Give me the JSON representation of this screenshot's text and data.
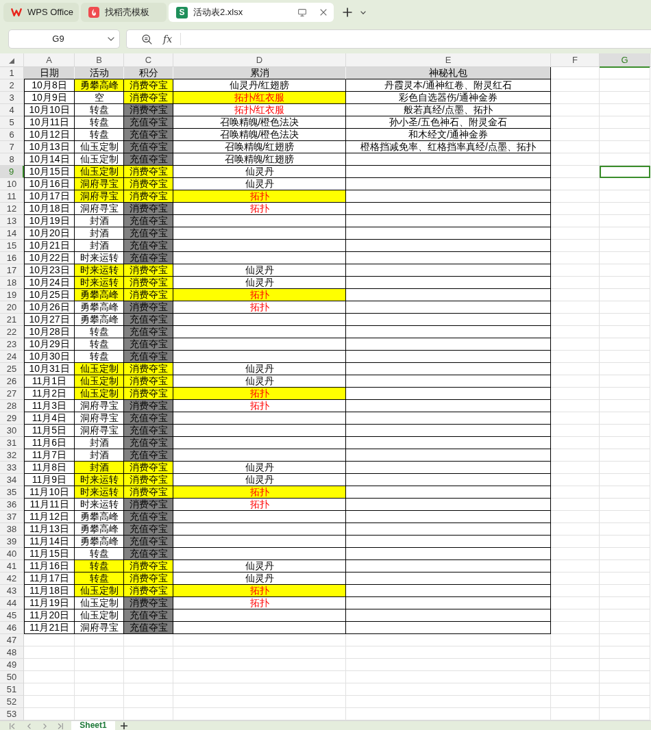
{
  "tabs": [
    {
      "kind": "wps",
      "label": "WPS Office",
      "selected": false
    },
    {
      "kind": "docer",
      "label": "找稻壳模板",
      "selected": false
    },
    {
      "kind": "sheet",
      "badge": "S",
      "label": "活动表2.xlsx",
      "selected": true
    }
  ],
  "name_box": {
    "value": "G9"
  },
  "formula_bar": {
    "function_button": "fx"
  },
  "columns": [
    {
      "label": "A",
      "selected": false
    },
    {
      "label": "B",
      "selected": false
    },
    {
      "label": "C",
      "selected": false
    },
    {
      "label": "D",
      "selected": false
    },
    {
      "label": "E",
      "selected": false
    },
    {
      "label": "F",
      "selected": false
    },
    {
      "label": "G",
      "selected": true
    }
  ],
  "row_numbers": [
    {
      "label": "1",
      "selected": false
    },
    {
      "label": "2",
      "selected": false
    },
    {
      "label": "3",
      "selected": false
    },
    {
      "label": "4",
      "selected": false
    },
    {
      "label": "5",
      "selected": false
    },
    {
      "label": "6",
      "selected": false
    },
    {
      "label": "7",
      "selected": false
    },
    {
      "label": "8",
      "selected": false
    },
    {
      "label": "9",
      "selected": true
    },
    {
      "label": "10",
      "selected": false
    },
    {
      "label": "11",
      "selected": false
    },
    {
      "label": "12",
      "selected": false
    },
    {
      "label": "13",
      "selected": false
    },
    {
      "label": "14",
      "selected": false
    },
    {
      "label": "15",
      "selected": false
    },
    {
      "label": "16",
      "selected": false
    },
    {
      "label": "17",
      "selected": false
    },
    {
      "label": "18",
      "selected": false
    },
    {
      "label": "19",
      "selected": false
    },
    {
      "label": "20",
      "selected": false
    },
    {
      "label": "21",
      "selected": false
    },
    {
      "label": "22",
      "selected": false
    },
    {
      "label": "23",
      "selected": false
    },
    {
      "label": "24",
      "selected": false
    },
    {
      "label": "25",
      "selected": false
    },
    {
      "label": "26",
      "selected": false
    },
    {
      "label": "27",
      "selected": false
    },
    {
      "label": "28",
      "selected": false
    },
    {
      "label": "29",
      "selected": false
    },
    {
      "label": "30",
      "selected": false
    },
    {
      "label": "31",
      "selected": false
    },
    {
      "label": "32",
      "selected": false
    },
    {
      "label": "33",
      "selected": false
    },
    {
      "label": "34",
      "selected": false
    },
    {
      "label": "35",
      "selected": false
    },
    {
      "label": "36",
      "selected": false
    },
    {
      "label": "37",
      "selected": false
    },
    {
      "label": "38",
      "selected": false
    },
    {
      "label": "39",
      "selected": false
    },
    {
      "label": "40",
      "selected": false
    },
    {
      "label": "41",
      "selected": false
    },
    {
      "label": "42",
      "selected": false
    },
    {
      "label": "43",
      "selected": false
    },
    {
      "label": "44",
      "selected": false
    },
    {
      "label": "45",
      "selected": false
    },
    {
      "label": "46",
      "selected": false
    },
    {
      "label": "47",
      "selected": false
    },
    {
      "label": "48",
      "selected": false
    },
    {
      "label": "49",
      "selected": false
    },
    {
      "label": "50",
      "selected": false
    },
    {
      "label": "51",
      "selected": false
    },
    {
      "label": "52",
      "selected": false
    },
    {
      "label": "53",
      "selected": false
    }
  ],
  "header": [
    "日期",
    "活动",
    "积分",
    "累消",
    "神秘礼包"
  ],
  "rows": [
    {
      "date": "10月8日",
      "activity": {
        "text": "勇攀高峰",
        "color": "#ffff00"
      },
      "points": {
        "text": "消费夺宝",
        "color": "#ffff00"
      },
      "cumulative": {
        "text": "仙灵丹/红翅膀",
        "red_text": false
      },
      "gift": "丹霞灵本/通神红卷、附灵红石"
    },
    {
      "date": "10月9日",
      "activity": {
        "text": "空"
      },
      "points": {
        "text": "消费夺宝",
        "color": "#ffff00"
      },
      "cumulative": {
        "text": "拓扑/红衣服",
        "color": "#ffff00",
        "red_text": true
      },
      "gift": "彩色自选器伤/通神金券"
    },
    {
      "date": "10月10日",
      "activity": {
        "text": "转盘"
      },
      "points": {
        "text": "消费夺宝",
        "color": "#808080"
      },
      "cumulative": {
        "text": "拓扑/红衣服",
        "red_text": true
      },
      "gift": "般若真经/点墨、拓扑"
    },
    {
      "date": "10月11日",
      "activity": {
        "text": "转盘"
      },
      "points": {
        "text": "充值夺宝",
        "color": "#808080"
      },
      "cumulative": {
        "text": "召唤精魄/橙色法决",
        "red_text": false
      },
      "gift": "孙小圣/五色神石、附灵金石"
    },
    {
      "date": "10月12日",
      "activity": {
        "text": "转盘"
      },
      "points": {
        "text": "充值夺宝",
        "color": "#808080"
      },
      "cumulative": {
        "text": "召唤精魄/橙色法决",
        "red_text": false
      },
      "gift": "和木经文/通神金券"
    },
    {
      "date": "10月13日",
      "activity": {
        "text": "仙玉定制"
      },
      "points": {
        "text": "充值夺宝",
        "color": "#808080"
      },
      "cumulative": {
        "text": "召唤精魄/红翅膀",
        "red_text": false
      },
      "gift": "橙格挡减免率、红格挡率真经/点墨、拓扑"
    },
    {
      "date": "10月14日",
      "activity": {
        "text": "仙玉定制"
      },
      "points": {
        "text": "充值夺宝",
        "color": "#808080"
      },
      "cumulative": {
        "text": "召唤精魄/红翅膀",
        "red_text": false
      }
    },
    {
      "date": "10月15日",
      "activity": {
        "text": "仙玉定制",
        "color": "#ffff00"
      },
      "points": {
        "text": "消费夺宝",
        "color": "#ffff00"
      },
      "cumulative": {
        "text": "仙灵丹",
        "red_text": false
      }
    },
    {
      "date": "10月16日",
      "activity": {
        "text": "洞府寻宝",
        "color": "#ffff00"
      },
      "points": {
        "text": "消费夺宝",
        "color": "#ffff00"
      },
      "cumulative": {
        "text": "仙灵丹",
        "red_text": false
      }
    },
    {
      "date": "10月17日",
      "activity": {
        "text": "洞府寻宝",
        "color": "#ffff00"
      },
      "points": {
        "text": "消费夺宝",
        "color": "#ffff00"
      },
      "cumulative": {
        "text": "拓扑",
        "color": "#ffff00",
        "red_text": true
      }
    },
    {
      "date": "10月18日",
      "activity": {
        "text": "洞府寻宝"
      },
      "points": {
        "text": "消费夺宝",
        "color": "#808080"
      },
      "cumulative": {
        "text": "拓扑",
        "red_text": true
      }
    },
    {
      "date": "10月19日",
      "activity": {
        "text": "封酒"
      },
      "points": {
        "text": "充值夺宝",
        "color": "#808080"
      }
    },
    {
      "date": "10月20日",
      "activity": {
        "text": "封酒"
      },
      "points": {
        "text": "充值夺宝",
        "color": "#808080"
      }
    },
    {
      "date": "10月21日",
      "activity": {
        "text": "封酒"
      },
      "points": {
        "text": "充值夺宝",
        "color": "#808080"
      }
    },
    {
      "date": "10月22日",
      "activity": {
        "text": "时来运转"
      },
      "points": {
        "text": "充值夺宝",
        "color": "#808080"
      }
    },
    {
      "date": "10月23日",
      "activity": {
        "text": "时来运转",
        "color": "#ffff00"
      },
      "points": {
        "text": "消费夺宝",
        "color": "#ffff00"
      },
      "cumulative": {
        "text": "仙灵丹",
        "red_text": false
      }
    },
    {
      "date": "10月24日",
      "activity": {
        "text": "时来运转",
        "color": "#ffff00"
      },
      "points": {
        "text": "消费夺宝",
        "color": "#ffff00"
      },
      "cumulative": {
        "text": "仙灵丹",
        "red_text": false
      }
    },
    {
      "date": "10月25日",
      "activity": {
        "text": "勇攀高峰",
        "color": "#ffff00"
      },
      "points": {
        "text": "消费夺宝",
        "color": "#ffff00"
      },
      "cumulative": {
        "text": "拓扑",
        "color": "#ffff00",
        "red_text": true
      }
    },
    {
      "date": "10月26日",
      "activity": {
        "text": "勇攀高峰"
      },
      "points": {
        "text": "消费夺宝",
        "color": "#808080"
      },
      "cumulative": {
        "text": "拓扑",
        "red_text": true
      }
    },
    {
      "date": "10月27日",
      "activity": {
        "text": "勇攀高峰"
      },
      "points": {
        "text": "充值夺宝",
        "color": "#808080"
      }
    },
    {
      "date": "10月28日",
      "activity": {
        "text": "转盘"
      },
      "points": {
        "text": "充值夺宝",
        "color": "#808080"
      }
    },
    {
      "date": "10月29日",
      "activity": {
        "text": "转盘"
      },
      "points": {
        "text": "充值夺宝",
        "color": "#808080"
      }
    },
    {
      "date": "10月30日",
      "activity": {
        "text": "转盘"
      },
      "points": {
        "text": "充值夺宝",
        "color": "#808080"
      }
    },
    {
      "date": "10月31日",
      "activity": {
        "text": "仙玉定制",
        "color": "#ffff00"
      },
      "points": {
        "text": "消费夺宝",
        "color": "#ffff00"
      },
      "cumulative": {
        "text": "仙灵丹",
        "red_text": false
      }
    },
    {
      "date": "11月1日",
      "activity": {
        "text": "仙玉定制",
        "color": "#ffff00"
      },
      "points": {
        "text": "消费夺宝",
        "color": "#ffff00"
      },
      "cumulative": {
        "text": "仙灵丹",
        "red_text": false
      }
    },
    {
      "date": "11月2日",
      "activity": {
        "text": "仙玉定制",
        "color": "#ffff00"
      },
      "points": {
        "text": "消费夺宝",
        "color": "#ffff00"
      },
      "cumulative": {
        "text": "拓扑",
        "color": "#ffff00",
        "red_text": true
      }
    },
    {
      "date": "11月3日",
      "activity": {
        "text": "洞府寻宝"
      },
      "points": {
        "text": "消费夺宝",
        "color": "#808080"
      },
      "cumulative": {
        "text": "拓扑",
        "red_text": true
      }
    },
    {
      "date": "11月4日",
      "activity": {
        "text": "洞府寻宝"
      },
      "points": {
        "text": "充值夺宝",
        "color": "#808080"
      }
    },
    {
      "date": "11月5日",
      "activity": {
        "text": "洞府寻宝"
      },
      "points": {
        "text": "充值夺宝",
        "color": "#808080"
      }
    },
    {
      "date": "11月6日",
      "activity": {
        "text": "封酒"
      },
      "points": {
        "text": "充值夺宝",
        "color": "#808080"
      }
    },
    {
      "date": "11月7日",
      "activity": {
        "text": "封酒"
      },
      "points": {
        "text": "充值夺宝",
        "color": "#808080"
      }
    },
    {
      "date": "11月8日",
      "activity": {
        "text": "封酒",
        "color": "#ffff00"
      },
      "points": {
        "text": "消费夺宝",
        "color": "#ffff00"
      },
      "cumulative": {
        "text": "仙灵丹",
        "red_text": false
      }
    },
    {
      "date": "11月9日",
      "activity": {
        "text": "时来运转",
        "color": "#ffff00"
      },
      "points": {
        "text": "消费夺宝",
        "color": "#ffff00"
      },
      "cumulative": {
        "text": "仙灵丹",
        "red_text": false
      }
    },
    {
      "date": "11月10日",
      "activity": {
        "text": "时来运转",
        "color": "#ffff00"
      },
      "points": {
        "text": "消费夺宝",
        "color": "#ffff00"
      },
      "cumulative": {
        "text": "拓扑",
        "color": "#ffff00",
        "red_text": true
      }
    },
    {
      "date": "11月11日",
      "activity": {
        "text": "时来运转"
      },
      "points": {
        "text": "消费夺宝",
        "color": "#808080"
      },
      "cumulative": {
        "text": "拓扑",
        "red_text": true
      }
    },
    {
      "date": "11月12日",
      "activity": {
        "text": "勇攀高峰"
      },
      "points": {
        "text": "充值夺宝",
        "color": "#808080"
      }
    },
    {
      "date": "11月13日",
      "activity": {
        "text": "勇攀高峰"
      },
      "points": {
        "text": "充值夺宝",
        "color": "#808080"
      }
    },
    {
      "date": "11月14日",
      "activity": {
        "text": "勇攀高峰"
      },
      "points": {
        "text": "充值夺宝",
        "color": "#808080"
      }
    },
    {
      "date": "11月15日",
      "activity": {
        "text": "转盘"
      },
      "points": {
        "text": "充值夺宝",
        "color": "#808080"
      }
    },
    {
      "date": "11月16日",
      "activity": {
        "text": "转盘",
        "color": "#ffff00"
      },
      "points": {
        "text": "消费夺宝",
        "color": "#ffff00"
      },
      "cumulative": {
        "text": "仙灵丹",
        "red_text": false
      }
    },
    {
      "date": "11月17日",
      "activity": {
        "text": "转盘",
        "color": "#ffff00"
      },
      "points": {
        "text": "消费夺宝",
        "color": "#ffff00"
      },
      "cumulative": {
        "text": "仙灵丹",
        "red_text": false
      }
    },
    {
      "date": "11月18日",
      "activity": {
        "text": "仙玉定制",
        "color": "#ffff00"
      },
      "points": {
        "text": "消费夺宝",
        "color": "#ffff00"
      },
      "cumulative": {
        "text": "拓扑",
        "color": "#ffff00",
        "red_text": true
      }
    },
    {
      "date": "11月19日",
      "activity": {
        "text": "仙玉定制"
      },
      "points": {
        "text": "消费夺宝",
        "color": "#808080"
      },
      "cumulative": {
        "text": "拓扑",
        "red_text": true
      }
    },
    {
      "date": "11月20日",
      "activity": {
        "text": "仙玉定制"
      },
      "points": {
        "text": "充值夺宝",
        "color": "#808080"
      }
    },
    {
      "date": "11月21日",
      "activity": {
        "text": "洞府寻宝"
      },
      "points": {
        "text": "充值夺宝",
        "color": "#808080"
      }
    }
  ],
  "sheet_tabs": [
    {
      "label": "Sheet1",
      "selected": true
    }
  ]
}
